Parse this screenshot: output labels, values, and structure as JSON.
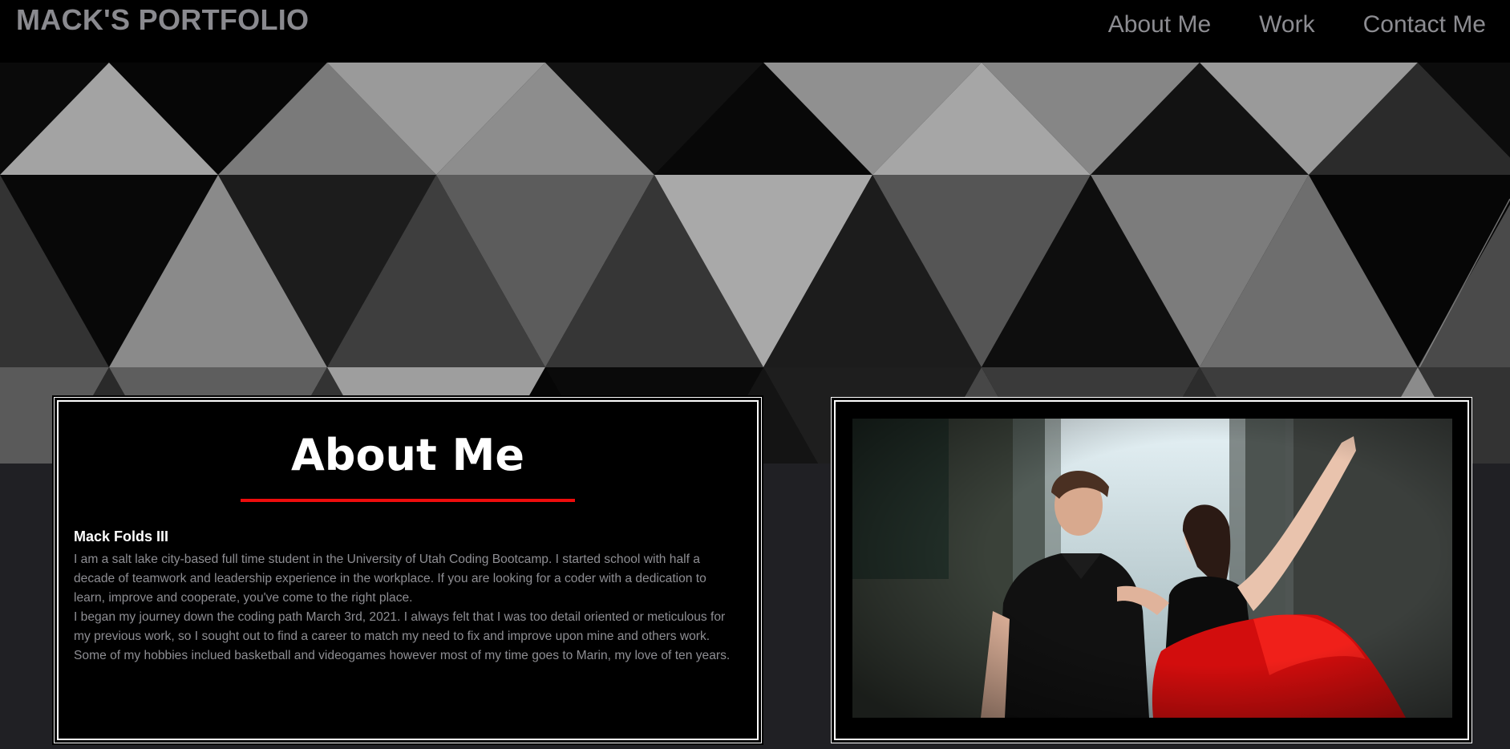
{
  "header": {
    "brand": "MACK'S PORTFOLIO",
    "nav": [
      {
        "label": "About Me"
      },
      {
        "label": "Work"
      },
      {
        "label": "Contact Me"
      }
    ]
  },
  "about": {
    "title": "About Me",
    "name": "Mack Folds III",
    "paragraph_1": "I am a salt lake city-based full time student in the University of Utah Coding Bootcamp. I started school with half a decade of teamwork and leadership experience in the workplace. If you are looking for a coder with a dedication to learn, improve and cooperate, you've come to the right place.",
    "paragraph_2": "I began my journey down the coding path March 3rd, 2021. I always felt that I was too detail oriented or meticulous for my previous work, so I sought out to find a career to match my need to fix and improve upon mine and others work. Some of my hobbies inclued basketball and videogames however most of my time goes to Marin, my love of ten years."
  },
  "colors": {
    "header_bg": "#000000",
    "page_bg": "#202024",
    "brand_text": "#8a8a8f",
    "nav_text": "#8c8c91",
    "accent_underline": "#ee0c0c",
    "panel_bg": "#000000",
    "panel_border": "#ffffff",
    "body_text": "#8e8e93"
  },
  "icons": {
    "photo": "couple-portrait-photo"
  }
}
